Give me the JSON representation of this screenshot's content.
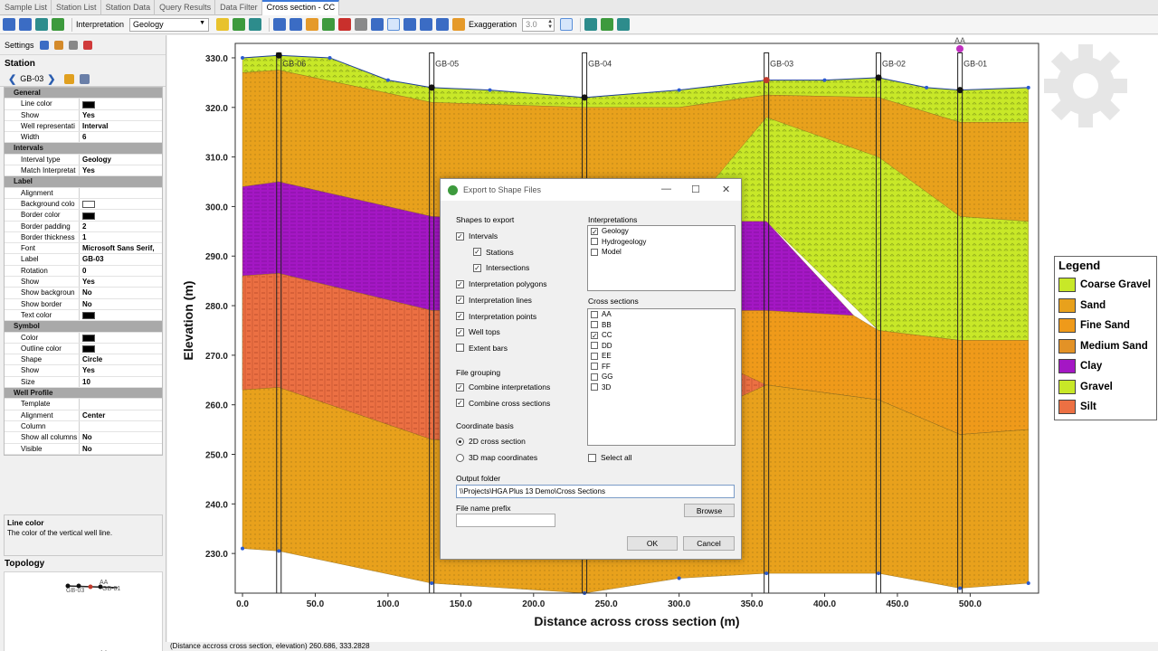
{
  "tabs": [
    "Sample List",
    "Station List",
    "Station Data",
    "Query Results",
    "Data Filter",
    "Cross section - CC"
  ],
  "toolbar": {
    "interpretation_label": "Interpretation",
    "interpretation_value": "Geology",
    "exaggeration_label": "Exaggeration",
    "exaggeration_value": "3.0"
  },
  "left_panel": {
    "settings_label": "Settings",
    "station_title": "Station",
    "station_id": "GB-03",
    "grid": [
      {
        "type": "cat",
        "label": "General"
      },
      {
        "label": "Line color",
        "swatch": "#000000"
      },
      {
        "label": "Show",
        "value": "Yes"
      },
      {
        "label": "Well representati",
        "value": "Interval"
      },
      {
        "label": "Width",
        "value": "6"
      },
      {
        "type": "cat",
        "label": "Intervals"
      },
      {
        "label": "Interval type",
        "value": "Geology"
      },
      {
        "label": "Match Interpretat",
        "value": "Yes"
      },
      {
        "type": "cat",
        "label": "Label"
      },
      {
        "label": "Alignment",
        "value": ""
      },
      {
        "label": "Background colo",
        "swatch": "#ffffff"
      },
      {
        "label": "Border color",
        "swatch": "#000000"
      },
      {
        "label": "Border padding",
        "value": "2"
      },
      {
        "label": "Border thickness",
        "value": "1"
      },
      {
        "label": "Font",
        "value": "Microsoft Sans Serif,"
      },
      {
        "label": "Label",
        "value": "GB-03"
      },
      {
        "label": "Rotation",
        "value": "0"
      },
      {
        "label": "Show",
        "value": "Yes"
      },
      {
        "label": "Show backgroun",
        "value": "No"
      },
      {
        "label": "Show border",
        "value": "No"
      },
      {
        "label": "Text color",
        "swatch": "#000000"
      },
      {
        "type": "cat",
        "label": "Symbol"
      },
      {
        "label": "Color",
        "swatch": "#000000"
      },
      {
        "label": "Outline color",
        "swatch": "#000000"
      },
      {
        "label": "Shape",
        "value": "Circle"
      },
      {
        "label": "Show",
        "value": "Yes"
      },
      {
        "label": "Size",
        "value": "10"
      },
      {
        "type": "cat",
        "label": "Well Profile"
      },
      {
        "label": "Template",
        "value": ""
      },
      {
        "label": "Alignment",
        "value": "Center"
      },
      {
        "label": "Column",
        "value": ""
      },
      {
        "label": "Show all columns",
        "value": "No"
      },
      {
        "label": "Visible",
        "value": "No"
      }
    ],
    "description_title": "Line color",
    "description_text": "The color of the vertical well line.",
    "topology_title": "Topology",
    "topology_labels": [
      "GB-03",
      "GB-01",
      "AA"
    ]
  },
  "chart_data": {
    "type": "area",
    "xlabel": "Distance across cross section (m)",
    "ylabel": "Elevation (m)",
    "xlim": [
      -5,
      547
    ],
    "ylim": [
      222,
      332
    ],
    "x_ticks": [
      "0.0",
      "50.0",
      "100.0",
      "150.0",
      "200.0",
      "250.0",
      "300.0",
      "350.0",
      "400.0",
      "450.0",
      "500.0"
    ],
    "y_ticks": [
      "330.0",
      "320.0",
      "310.0",
      "300.0",
      "290.0",
      "280.0",
      "270.0",
      "260.0",
      "250.0",
      "240.0",
      "230.0"
    ],
    "wells": [
      {
        "name": "GB-06",
        "x": 25
      },
      {
        "name": "GB-05",
        "x": 130
      },
      {
        "name": "GB-04",
        "x": 235
      },
      {
        "name": "GB-03",
        "x": 360
      },
      {
        "name": "GB-02",
        "x": 437
      },
      {
        "name": "GB-01",
        "x": 493
      }
    ],
    "marker_label": "AA",
    "layers": [
      {
        "name": "Gravel",
        "color": "#c8e828",
        "top": [
          [
            0,
            330
          ],
          [
            25,
            330.5
          ],
          [
            60,
            330
          ],
          [
            100,
            325.5
          ],
          [
            130,
            324
          ],
          [
            170,
            323.5
          ],
          [
            235,
            322
          ],
          [
            300,
            323.5
          ],
          [
            360,
            325.5
          ],
          [
            400,
            325.5
          ],
          [
            437,
            326
          ],
          [
            470,
            324
          ],
          [
            493,
            323.5
          ],
          [
            540,
            324
          ]
        ],
        "bottom": [
          [
            0,
            327
          ],
          [
            25,
            327.5
          ],
          [
            130,
            321
          ],
          [
            235,
            320
          ],
          [
            300,
            320
          ],
          [
            360,
            322.5
          ],
          [
            437,
            322
          ],
          [
            493,
            317
          ],
          [
            540,
            317
          ]
        ]
      },
      {
        "name": "Sand",
        "color": "#e8a11c",
        "top": [
          [
            0,
            327
          ],
          [
            25,
            327.5
          ],
          [
            130,
            321
          ],
          [
            235,
            320
          ],
          [
            300,
            320
          ],
          [
            360,
            322.5
          ],
          [
            437,
            322
          ],
          [
            493,
            317
          ],
          [
            540,
            317
          ]
        ],
        "bottom": [
          [
            0,
            304
          ],
          [
            25,
            305
          ],
          [
            130,
            298
          ],
          [
            235,
            297
          ],
          [
            300,
            297
          ],
          [
            360,
            297
          ],
          [
            437,
            300
          ],
          [
            493,
            298
          ],
          [
            540,
            297
          ]
        ]
      },
      {
        "name": "Coarse Gravel",
        "color": "#c8e828",
        "top": [
          [
            300,
            297
          ],
          [
            360,
            318
          ],
          [
            437,
            310
          ],
          [
            493,
            298
          ],
          [
            540,
            297
          ]
        ],
        "bottom": [
          [
            300,
            297
          ],
          [
            360,
            297
          ],
          [
            437,
            275
          ],
          [
            493,
            273
          ],
          [
            540,
            273
          ]
        ]
      },
      {
        "name": "Clay",
        "color": "#a417c4",
        "top": [
          [
            0,
            304
          ],
          [
            25,
            305
          ],
          [
            130,
            298
          ],
          [
            235,
            297
          ],
          [
            300,
            297
          ],
          [
            360,
            297
          ],
          [
            420,
            278
          ]
        ],
        "bottom": [
          [
            0,
            286
          ],
          [
            25,
            286.5
          ],
          [
            130,
            279
          ],
          [
            235,
            279
          ],
          [
            300,
            279
          ],
          [
            360,
            279
          ],
          [
            420,
            278
          ]
        ]
      },
      {
        "name": "Fine Sand",
        "color": "#ef9a1a",
        "top": [
          [
            0,
            286
          ],
          [
            25,
            286.5
          ],
          [
            130,
            279
          ],
          [
            235,
            279
          ],
          [
            300,
            279
          ],
          [
            360,
            279
          ],
          [
            420,
            278
          ],
          [
            437,
            275
          ],
          [
            493,
            273
          ],
          [
            540,
            273
          ]
        ],
        "bottom": [
          [
            0,
            263
          ],
          [
            25,
            263.5
          ],
          [
            130,
            253
          ],
          [
            235,
            251
          ],
          [
            300,
            256
          ],
          [
            360,
            264
          ],
          [
            437,
            261
          ],
          [
            493,
            254
          ],
          [
            540,
            255
          ]
        ]
      },
      {
        "name": "Silt",
        "color": "#ec7043",
        "top": [
          [
            0,
            286
          ],
          [
            25,
            286.5
          ],
          [
            130,
            279
          ],
          [
            235,
            279
          ],
          [
            280,
            275
          ],
          [
            360,
            264
          ],
          [
            437,
            261
          ],
          [
            493,
            254
          ],
          [
            540,
            255
          ]
        ],
        "bottom": [
          [
            0,
            263
          ],
          [
            25,
            263.5
          ],
          [
            130,
            253
          ],
          [
            235,
            251
          ],
          [
            300,
            256
          ],
          [
            360,
            264
          ],
          [
            437,
            261
          ],
          [
            493,
            254
          ],
          [
            540,
            255
          ]
        ]
      },
      {
        "name": "Sand",
        "color": "#e8a11c",
        "top": [
          [
            0,
            263
          ],
          [
            25,
            263.5
          ],
          [
            130,
            253
          ],
          [
            235,
            251
          ],
          [
            300,
            256
          ],
          [
            360,
            264
          ],
          [
            437,
            261
          ],
          [
            493,
            254
          ],
          [
            540,
            255
          ]
        ],
        "bottom": [
          [
            0,
            231
          ],
          [
            25,
            230.5
          ],
          [
            130,
            224
          ],
          [
            235,
            222
          ],
          [
            300,
            225
          ],
          [
            360,
            226
          ],
          [
            437,
            226
          ],
          [
            493,
            223
          ],
          [
            540,
            224
          ]
        ]
      }
    ],
    "legend": {
      "title": "Legend",
      "items": [
        {
          "label": "Coarse Gravel",
          "color": "#c8e828"
        },
        {
          "label": "Sand",
          "color": "#e8a11c"
        },
        {
          "label": "Fine Sand",
          "color": "#ef9a1a"
        },
        {
          "label": "Medium Sand",
          "color": "#e39226"
        },
        {
          "label": "Clay",
          "color": "#a417c4"
        },
        {
          "label": "Gravel",
          "color": "#c8e828"
        },
        {
          "label": "Silt",
          "color": "#ec7043"
        }
      ]
    }
  },
  "status": "(Distance accross cross section, elevation)  260.686, 333.2828",
  "dialog": {
    "title": "Export to Shape Files",
    "shapes_header": "Shapes to export",
    "shapes": [
      {
        "label": "Intervals",
        "checked": true,
        "indent": 0
      },
      {
        "label": "Stations",
        "checked": true,
        "indent": 1
      },
      {
        "label": "Intersections",
        "checked": true,
        "indent": 1
      },
      {
        "label": "Interpretation polygons",
        "checked": true,
        "indent": 0
      },
      {
        "label": "Interpretation lines",
        "checked": true,
        "indent": 0
      },
      {
        "label": "Interpretation points",
        "checked": true,
        "indent": 0
      },
      {
        "label": "Well tops",
        "checked": true,
        "indent": 0
      },
      {
        "label": "Extent bars",
        "checked": false,
        "indent": 0
      }
    ],
    "grouping_header": "File grouping",
    "grouping": [
      {
        "label": "Combine interpretations",
        "checked": true
      },
      {
        "label": "Combine cross sections",
        "checked": true
      }
    ],
    "coord_header": "Coordinate basis",
    "coord": [
      {
        "label": "2D cross section",
        "selected": true
      },
      {
        "label": "3D map coordinates",
        "selected": false
      }
    ],
    "interp_header": "Interpretations",
    "interpretations": [
      {
        "label": "Geology",
        "checked": true
      },
      {
        "label": "Hydrogeology",
        "checked": false
      },
      {
        "label": "Model",
        "checked": false
      }
    ],
    "xs_header": "Cross sections",
    "cross_sections": [
      {
        "label": "AA",
        "checked": false
      },
      {
        "label": "BB",
        "checked": false
      },
      {
        "label": "CC",
        "checked": true
      },
      {
        "label": "DD",
        "checked": false
      },
      {
        "label": "EE",
        "checked": false
      },
      {
        "label": "FF",
        "checked": false
      },
      {
        "label": "GG",
        "checked": false
      },
      {
        "label": "3D",
        "checked": false
      }
    ],
    "select_all": "Select all",
    "output_label": "Output folder",
    "output_value": "\\\\Projects\\HGA Plus 13 Demo\\Cross Sections",
    "prefix_label": "File name prefix",
    "prefix_value": "",
    "browse": "Browse",
    "ok": "OK",
    "cancel": "Cancel"
  }
}
